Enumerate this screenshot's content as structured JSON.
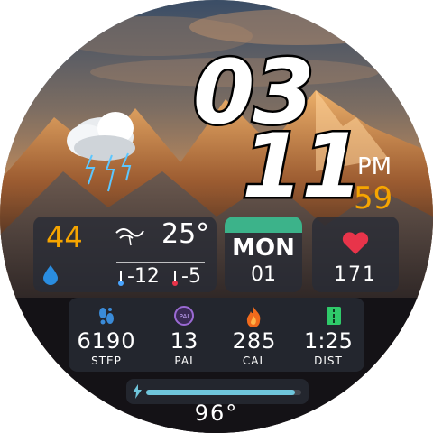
{
  "time": {
    "hour": "03",
    "minute": "11",
    "ampm": "PM",
    "seconds": "59"
  },
  "weather": {
    "humidity": "44",
    "temperature": "25°",
    "low": "-12",
    "high": "-5",
    "icon": "thunderstorm-cloud-icon",
    "humidity_icon": "water-drop-icon",
    "wind_icon": "wind-icon",
    "thermometer_icon": "thermometer-icon"
  },
  "date": {
    "weekday": "MON",
    "day": "01"
  },
  "heart": {
    "value": "171",
    "icon": "heart-icon"
  },
  "stats": [
    {
      "value": "6190",
      "label": "STEP",
      "icon": "footsteps-icon"
    },
    {
      "value": "13",
      "label": "PAI",
      "icon": "pai-icon"
    },
    {
      "value": "285",
      "label": "CAL",
      "icon": "flame-icon"
    },
    {
      "value": "1:25",
      "label": "DIST",
      "icon": "road-icon"
    }
  ],
  "battery": {
    "value": "96°",
    "level": 0.96,
    "icon": "lightning-icon"
  },
  "colors": {
    "accent_orange": "#f6a500",
    "date_bar": "#3cb38a",
    "heart": "#e8344a",
    "steps_icon": "#3a8bd8",
    "pai_icon": "#9b6ad4",
    "cal_icon": "#f06a1c",
    "dist_icon": "#2fca6a",
    "battery_fill": "#6fc6dc"
  }
}
